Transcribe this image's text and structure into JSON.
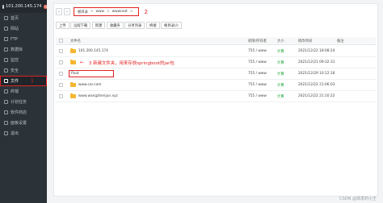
{
  "server": {
    "ip": "101.200.145.174",
    "badge": "0"
  },
  "sidebar": {
    "items": [
      {
        "label": "首页",
        "icon": "home-icon"
      },
      {
        "label": "网站",
        "icon": "globe-icon"
      },
      {
        "label": "FTP",
        "icon": "ftp-icon"
      },
      {
        "label": "数据库",
        "icon": "database-icon"
      },
      {
        "label": "监控",
        "icon": "monitor-icon"
      },
      {
        "label": "安全",
        "icon": "shield-icon"
      },
      {
        "label": "文件",
        "icon": "folder-icon",
        "active": true,
        "annotation": "1"
      },
      {
        "label": "终端",
        "icon": "terminal-icon"
      },
      {
        "label": "计划任务",
        "icon": "clock-icon"
      },
      {
        "label": "软件商店",
        "icon": "store-icon"
      },
      {
        "label": "面板设置",
        "icon": "gear-icon"
      },
      {
        "label": "退出",
        "icon": "logout-icon"
      }
    ]
  },
  "pathbar": {
    "crumbs": [
      "根目录",
      "www",
      "wwwroot"
    ],
    "annotation": "2"
  },
  "toolbar": {
    "buttons": [
      "上传",
      "远程下载",
      "新建",
      "收藏夹",
      "分享列表",
      "终端",
      "根目录"
    ],
    "upload": "上传",
    "remote_download": "远程下载",
    "new": "新建",
    "favorites": "收藏夹",
    "share_list": "分享列表",
    "terminal": "终端",
    "root_dir": "回收站",
    "disk": "根目录(/)"
  },
  "table": {
    "headers": {
      "name": "文件名",
      "perm": "权限/所有者",
      "size": "大小",
      "time": "修改时间",
      "note": "备注"
    },
    "rows": [
      {
        "name": "101.200.145.174",
        "perm": "755 / www",
        "size": "计算",
        "time": "2021/12/22 18:08:24"
      },
      {
        "name": "",
        "perm": "755 / www",
        "size": "计算",
        "time": "2021/12/21 09:32:31",
        "annotation": "3 新建文件夹，用来存放springboot的jar包"
      },
      {
        "name": "float",
        "perm": "755 / www",
        "size": "计算",
        "time": "2021/12/29 10:12:18"
      },
      {
        "name": "www.car.com",
        "perm": "755 / www",
        "size": "计算",
        "time": "2021/12/22 21:06:03"
      },
      {
        "name": "www.wangzhenjun.xyz",
        "perm": "755 / www",
        "size": "计算",
        "time": "2021/12/22 21:10:22"
      }
    ]
  },
  "watermark": "CSDN @掉发的小王"
}
